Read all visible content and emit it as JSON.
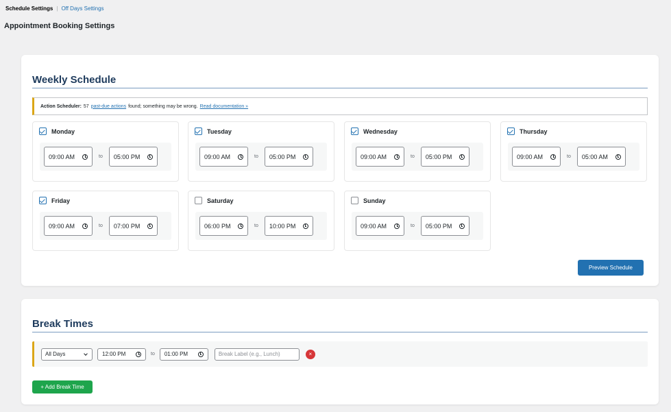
{
  "subnav": {
    "current": "Schedule Settings",
    "separator": "|",
    "link": "Off Days Settings"
  },
  "page_title": "Appointment Booking Settings",
  "weekly": {
    "title": "Weekly Schedule",
    "notice": {
      "label": "Action Scheduler:",
      "count_text": "57",
      "link": "past-due actions",
      "message": "found; something may be wrong.",
      "doc_link": "Read documentation »"
    },
    "to_label": "to",
    "days": [
      {
        "name": "Monday",
        "checked": true,
        "start": "09:00 AM",
        "end": "05:00 PM"
      },
      {
        "name": "Tuesday",
        "checked": true,
        "start": "09:00 AM",
        "end": "05:00 PM"
      },
      {
        "name": "Wednesday",
        "checked": true,
        "start": "09:00 AM",
        "end": "05:00 PM"
      },
      {
        "name": "Thursday",
        "checked": true,
        "start": "09:00 AM",
        "end": "05:00 AM"
      },
      {
        "name": "Friday",
        "checked": true,
        "start": "09:00 AM",
        "end": "07:00 PM"
      },
      {
        "name": "Saturday",
        "checked": false,
        "start": "06:00 PM",
        "end": "10:00 PM"
      },
      {
        "name": "Sunday",
        "checked": false,
        "start": "09:00 AM",
        "end": "05:00 PM"
      }
    ],
    "preview_button": "Preview Schedule"
  },
  "breaks": {
    "title": "Break Times",
    "row": {
      "day_select": "All Days",
      "start": "12:00 PM",
      "to_label": "to",
      "end": "01:00 PM",
      "label_placeholder": "Break Label (e.g., Lunch)",
      "remove_symbol": "×"
    },
    "add_button": "+ Add Break Time"
  },
  "colors": {
    "primary": "#2271b1",
    "success": "#1ea54c",
    "warning": "#dba617",
    "danger": "#d63638"
  }
}
